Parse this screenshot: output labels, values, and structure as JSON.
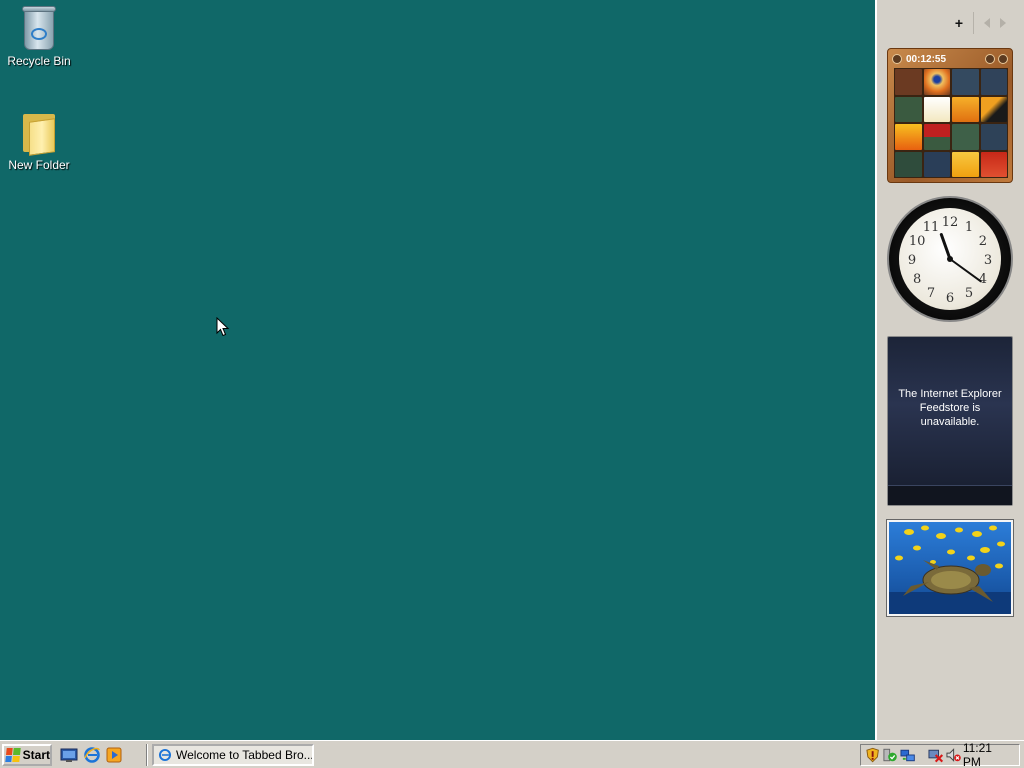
{
  "desktop": {
    "icons": [
      {
        "label": "Recycle Bin",
        "icon": "recycle-bin-icon"
      },
      {
        "label": "New Folder",
        "icon": "folder-icon"
      }
    ]
  },
  "sidebar": {
    "add_label": "+",
    "puzzle": {
      "timer": "00:12:55"
    },
    "clock": {
      "numerals": [
        "12",
        "1",
        "2",
        "3",
        "4",
        "5",
        "6",
        "7",
        "8",
        "9",
        "10",
        "11"
      ],
      "time_shown": "11:21"
    },
    "feed": {
      "message": "The Internet Explorer Feedstore is unavailable."
    }
  },
  "taskbar": {
    "start_label": "Start",
    "quick_launch": [
      "show-desktop-icon",
      "internet-explorer-icon",
      "media-player-icon"
    ],
    "task_button": "Welcome to Tabbed Bro...",
    "clock": "11:21 PM",
    "tray_icons": [
      "shield-icon",
      "security-center-icon",
      "network-icon",
      "network-disconnected-icon",
      "volume-muted-icon"
    ]
  },
  "colors": {
    "desktop": "#106868",
    "taskbar": "#d4d0c8"
  }
}
